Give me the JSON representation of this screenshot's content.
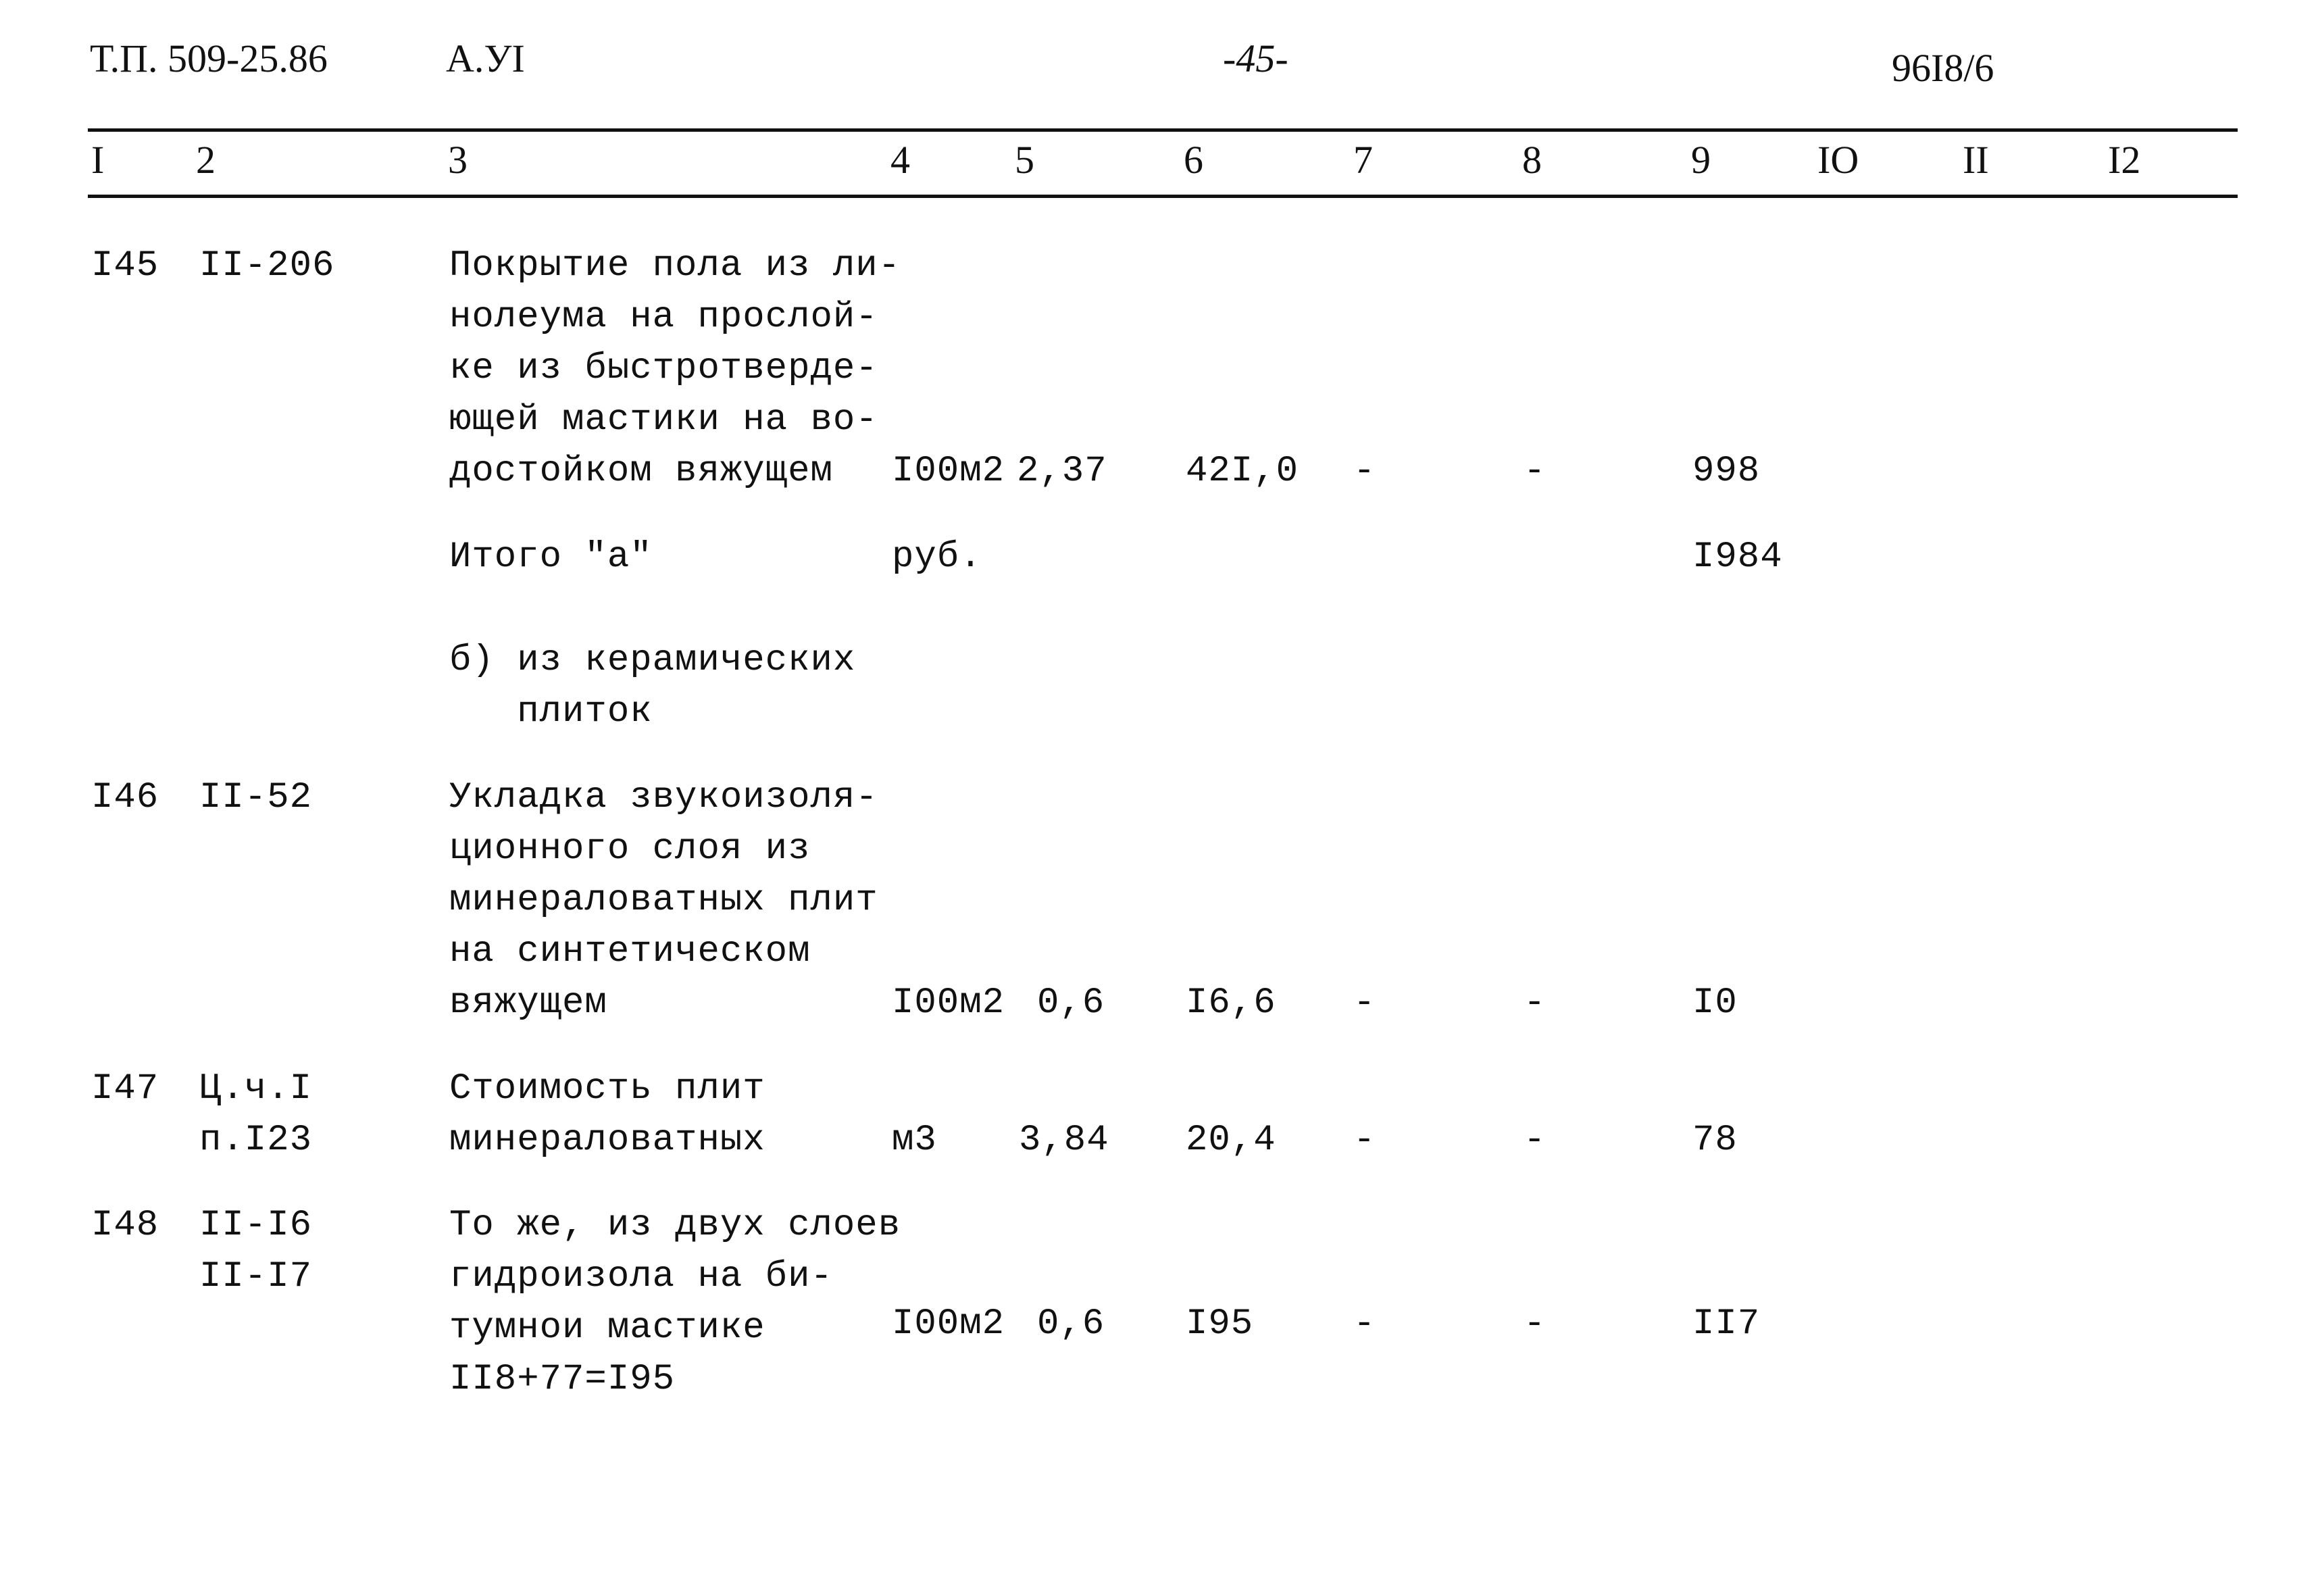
{
  "page_header": {
    "doc_code": "Т.П. 509-25.86",
    "album": "А.УI",
    "page_number": "-45-",
    "sheet_code": "96I8/6"
  },
  "table": {
    "column_headers": [
      "I",
      "2",
      "3",
      "4",
      "5",
      "6",
      "7",
      "8",
      "9",
      "IO",
      "II",
      "I2"
    ],
    "rows": [
      {
        "num": "I45",
        "code": [
          "II-206"
        ],
        "description": [
          "Покрытие пола из ли-",
          "нолеума на прослой-",
          "ке из быстротверде-",
          "ющей мастики на во-",
          "достойком вяжущем"
        ],
        "unit": "I00м2",
        "quantity": "2,37",
        "price": "42I,0",
        "col7": "-",
        "col8": "-",
        "col9": "998"
      },
      {
        "num": "",
        "code": [],
        "description": [
          "Итого \"а\""
        ],
        "unit": "руб.",
        "quantity": "",
        "price": "",
        "col7": "",
        "col8": "",
        "col9": "I984"
      },
      {
        "num": "",
        "code": [],
        "description": [
          "б) из керамических",
          "   плиток"
        ],
        "unit": "",
        "quantity": "",
        "price": "",
        "col7": "",
        "col8": "",
        "col9": ""
      },
      {
        "num": "I46",
        "code": [
          "II-52"
        ],
        "description": [
          "Укладка звукоизоля-",
          "ционного слоя из",
          "минераловатных плит",
          "на синтетическом",
          "вяжущем"
        ],
        "unit": "I00м2",
        "quantity": "0,6",
        "price": "I6,6",
        "col7": "-",
        "col8": "-",
        "col9": "I0"
      },
      {
        "num": "I47",
        "code": [
          "Ц.ч.I",
          "п.I23"
        ],
        "description": [
          "Стоимость плит",
          "минераловатных"
        ],
        "unit": "м3",
        "quantity": "3,84",
        "price": "20,4",
        "col7": "-",
        "col8": "-",
        "col9": "78"
      },
      {
        "num": "I48",
        "code": [
          "II-I6",
          "II-I7"
        ],
        "description": [
          "То же, из двух слоев",
          "гидроизола на би-",
          "тумнои мастике",
          "II8+77=I95"
        ],
        "unit": "I00м2",
        "quantity": "0,6",
        "price": "I95",
        "col7": "-",
        "col8": "-",
        "col9": "II7"
      }
    ]
  }
}
